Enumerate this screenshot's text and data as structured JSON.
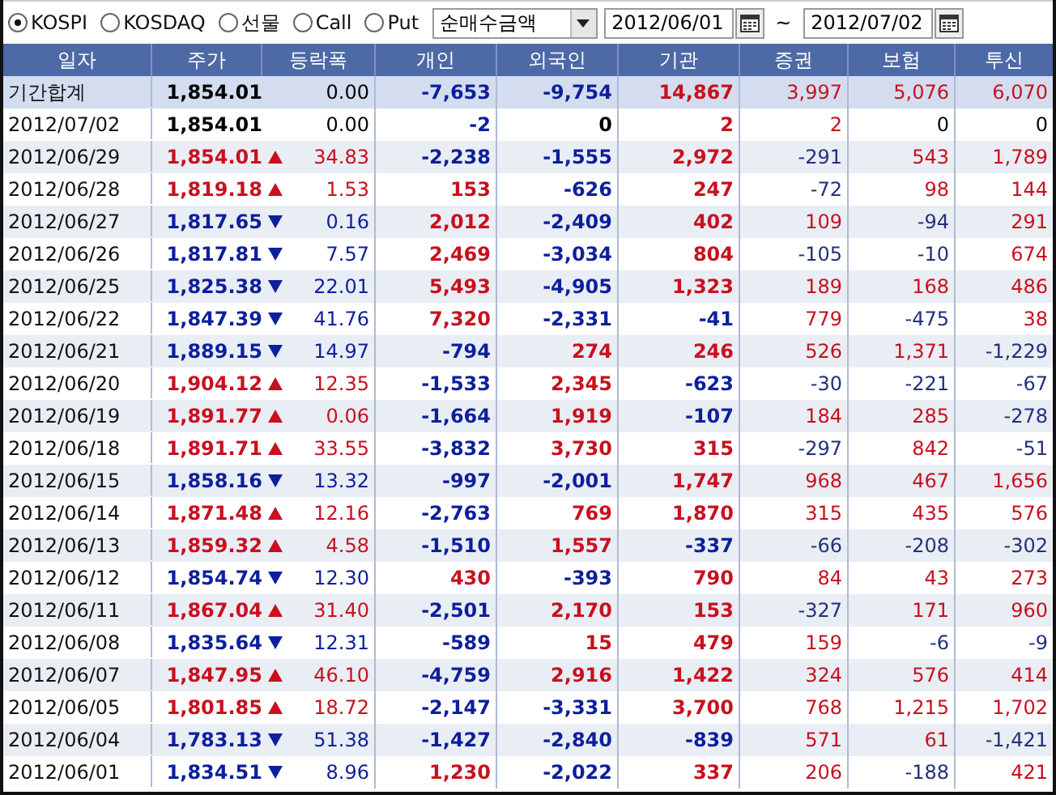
{
  "toolbar": {
    "markets": [
      {
        "label": "KOSPI",
        "selected": true
      },
      {
        "label": "KOSDAQ",
        "selected": false
      },
      {
        "label": "선물",
        "selected": false
      },
      {
        "label": "Call",
        "selected": false
      },
      {
        "label": "Put",
        "selected": false
      }
    ],
    "metric": "순매수금액",
    "from": "2012/06/01",
    "separator": "~",
    "to": "2012/07/02"
  },
  "table": {
    "columns": [
      "일자",
      "주가",
      "등락폭",
      "개인",
      "외국인",
      "기관",
      "증권",
      "보험",
      "투신"
    ],
    "rows": [
      {
        "kind": "total",
        "rose": false,
        "fell": false,
        "cells": [
          "기간합계",
          "1,854.01",
          "0.00",
          "-7,653",
          "-9,754",
          "14,867",
          "3,997",
          "5,076",
          "6,070"
        ]
      },
      {
        "kind": "day",
        "rose": false,
        "fell": false,
        "cells": [
          "2012/07/02",
          "1,854.01",
          "0.00",
          "-2",
          "0",
          "2",
          "2",
          "0",
          "0"
        ]
      },
      {
        "kind": "day",
        "rose": true,
        "fell": false,
        "cells": [
          "2012/06/29",
          "1,854.01",
          "34.83",
          "-2,238",
          "-1,555",
          "2,972",
          "-291",
          "543",
          "1,789"
        ]
      },
      {
        "kind": "day",
        "rose": true,
        "fell": false,
        "cells": [
          "2012/06/28",
          "1,819.18",
          "1.53",
          "153",
          "-626",
          "247",
          "-72",
          "98",
          "144"
        ]
      },
      {
        "kind": "day",
        "rose": false,
        "fell": true,
        "cells": [
          "2012/06/27",
          "1,817.65",
          "0.16",
          "2,012",
          "-2,409",
          "402",
          "109",
          "-94",
          "291"
        ]
      },
      {
        "kind": "day",
        "rose": false,
        "fell": true,
        "cells": [
          "2012/06/26",
          "1,817.81",
          "7.57",
          "2,469",
          "-3,034",
          "804",
          "-105",
          "-10",
          "674"
        ]
      },
      {
        "kind": "day",
        "rose": false,
        "fell": true,
        "cells": [
          "2012/06/25",
          "1,825.38",
          "22.01",
          "5,493",
          "-4,905",
          "1,323",
          "189",
          "168",
          "486"
        ]
      },
      {
        "kind": "day",
        "rose": false,
        "fell": true,
        "cells": [
          "2012/06/22",
          "1,847.39",
          "41.76",
          "7,320",
          "-2,331",
          "-41",
          "779",
          "-475",
          "38"
        ]
      },
      {
        "kind": "day",
        "rose": false,
        "fell": true,
        "cells": [
          "2012/06/21",
          "1,889.15",
          "14.97",
          "-794",
          "274",
          "246",
          "526",
          "1,371",
          "-1,229"
        ]
      },
      {
        "kind": "day",
        "rose": true,
        "fell": false,
        "cells": [
          "2012/06/20",
          "1,904.12",
          "12.35",
          "-1,533",
          "2,345",
          "-623",
          "-30",
          "-221",
          "-67"
        ]
      },
      {
        "kind": "day",
        "rose": true,
        "fell": false,
        "cells": [
          "2012/06/19",
          "1,891.77",
          "0.06",
          "-1,664",
          "1,919",
          "-107",
          "184",
          "285",
          "-278"
        ]
      },
      {
        "kind": "day",
        "rose": true,
        "fell": false,
        "cells": [
          "2012/06/18",
          "1,891.71",
          "33.55",
          "-3,832",
          "3,730",
          "315",
          "-297",
          "842",
          "-51"
        ]
      },
      {
        "kind": "day",
        "rose": false,
        "fell": true,
        "cells": [
          "2012/06/15",
          "1,858.16",
          "13.32",
          "-997",
          "-2,001",
          "1,747",
          "968",
          "467",
          "1,656"
        ]
      },
      {
        "kind": "day",
        "rose": true,
        "fell": false,
        "cells": [
          "2012/06/14",
          "1,871.48",
          "12.16",
          "-2,763",
          "769",
          "1,870",
          "315",
          "435",
          "576"
        ]
      },
      {
        "kind": "day",
        "rose": true,
        "fell": false,
        "cells": [
          "2012/06/13",
          "1,859.32",
          "4.58",
          "-1,510",
          "1,557",
          "-337",
          "-66",
          "-208",
          "-302"
        ]
      },
      {
        "kind": "day",
        "rose": false,
        "fell": true,
        "cells": [
          "2012/06/12",
          "1,854.74",
          "12.30",
          "430",
          "-393",
          "790",
          "84",
          "43",
          "273"
        ]
      },
      {
        "kind": "day",
        "rose": true,
        "fell": false,
        "cells": [
          "2012/06/11",
          "1,867.04",
          "31.40",
          "-2,501",
          "2,170",
          "153",
          "-327",
          "171",
          "960"
        ]
      },
      {
        "kind": "day",
        "rose": false,
        "fell": true,
        "cells": [
          "2012/06/08",
          "1,835.64",
          "12.31",
          "-589",
          "15",
          "479",
          "159",
          "-6",
          "-9"
        ]
      },
      {
        "kind": "day",
        "rose": true,
        "fell": false,
        "cells": [
          "2012/06/07",
          "1,847.95",
          "46.10",
          "-4,759",
          "2,916",
          "1,422",
          "324",
          "576",
          "414"
        ]
      },
      {
        "kind": "day",
        "rose": true,
        "fell": false,
        "cells": [
          "2012/06/05",
          "1,801.85",
          "18.72",
          "-2,147",
          "-3,331",
          "3,700",
          "768",
          "1,215",
          "1,702"
        ]
      },
      {
        "kind": "day",
        "rose": false,
        "fell": true,
        "cells": [
          "2012/06/04",
          "1,783.13",
          "51.38",
          "-1,427",
          "-2,840",
          "-839",
          "571",
          "61",
          "-1,421"
        ]
      },
      {
        "kind": "day",
        "rose": false,
        "fell": true,
        "cells": [
          "2012/06/01",
          "1,834.51",
          "8.96",
          "1,230",
          "-2,022",
          "337",
          "206",
          "-188",
          "421"
        ]
      }
    ]
  }
}
